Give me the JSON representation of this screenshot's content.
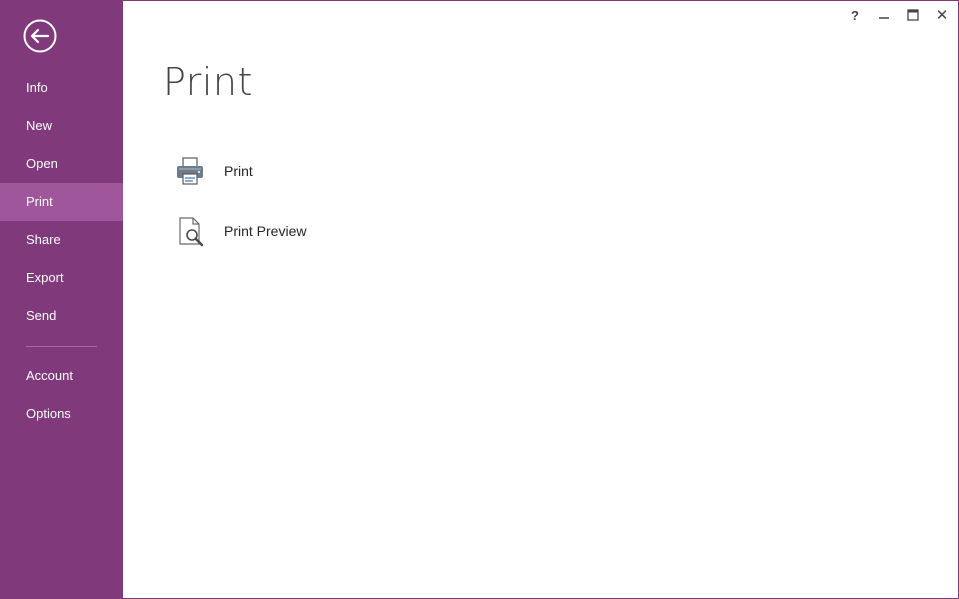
{
  "window": {
    "help_label": "?",
    "minimize_label": "–",
    "close_label": "✕"
  },
  "sidebar": {
    "items": [
      {
        "label": "Info"
      },
      {
        "label": "New"
      },
      {
        "label": "Open"
      },
      {
        "label": "Print",
        "active": true
      },
      {
        "label": "Share"
      },
      {
        "label": "Export"
      },
      {
        "label": "Send"
      },
      {
        "label": "Account"
      },
      {
        "label": "Options"
      }
    ]
  },
  "main": {
    "title": "Print",
    "commands": [
      {
        "label": "Print",
        "icon": "printer-icon"
      },
      {
        "label": "Print Preview",
        "icon": "print-preview-icon"
      }
    ]
  },
  "colors": {
    "accent": "#80397b",
    "accent_active": "#a0569a"
  }
}
